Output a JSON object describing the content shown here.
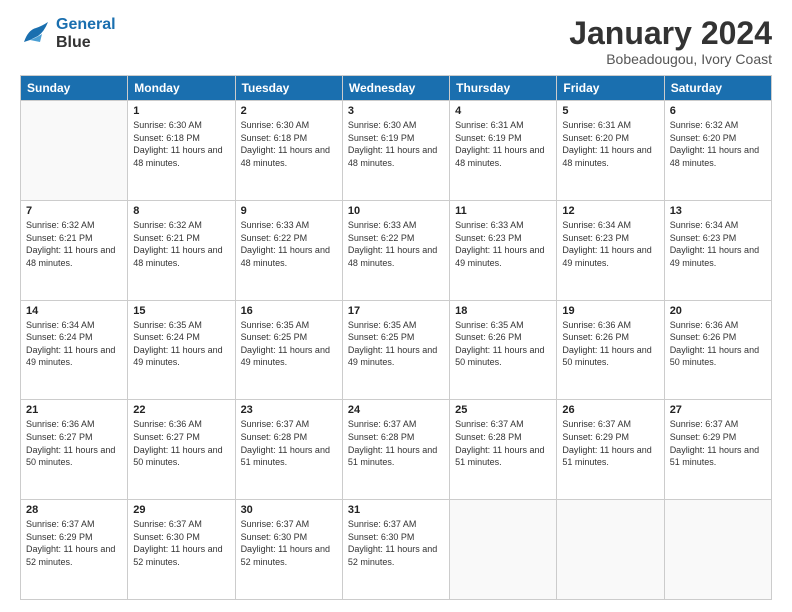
{
  "logo": {
    "line1": "General",
    "line2": "Blue"
  },
  "title": "January 2024",
  "location": "Bobeadougou, Ivory Coast",
  "days_header": [
    "Sunday",
    "Monday",
    "Tuesday",
    "Wednesday",
    "Thursday",
    "Friday",
    "Saturday"
  ],
  "weeks": [
    [
      {
        "day": "",
        "sunrise": "",
        "sunset": "",
        "daylight": ""
      },
      {
        "day": "1",
        "sunrise": "Sunrise: 6:30 AM",
        "sunset": "Sunset: 6:18 PM",
        "daylight": "Daylight: 11 hours and 48 minutes."
      },
      {
        "day": "2",
        "sunrise": "Sunrise: 6:30 AM",
        "sunset": "Sunset: 6:18 PM",
        "daylight": "Daylight: 11 hours and 48 minutes."
      },
      {
        "day": "3",
        "sunrise": "Sunrise: 6:30 AM",
        "sunset": "Sunset: 6:19 PM",
        "daylight": "Daylight: 11 hours and 48 minutes."
      },
      {
        "day": "4",
        "sunrise": "Sunrise: 6:31 AM",
        "sunset": "Sunset: 6:19 PM",
        "daylight": "Daylight: 11 hours and 48 minutes."
      },
      {
        "day": "5",
        "sunrise": "Sunrise: 6:31 AM",
        "sunset": "Sunset: 6:20 PM",
        "daylight": "Daylight: 11 hours and 48 minutes."
      },
      {
        "day": "6",
        "sunrise": "Sunrise: 6:32 AM",
        "sunset": "Sunset: 6:20 PM",
        "daylight": "Daylight: 11 hours and 48 minutes."
      }
    ],
    [
      {
        "day": "7",
        "sunrise": "Sunrise: 6:32 AM",
        "sunset": "Sunset: 6:21 PM",
        "daylight": "Daylight: 11 hours and 48 minutes."
      },
      {
        "day": "8",
        "sunrise": "Sunrise: 6:32 AM",
        "sunset": "Sunset: 6:21 PM",
        "daylight": "Daylight: 11 hours and 48 minutes."
      },
      {
        "day": "9",
        "sunrise": "Sunrise: 6:33 AM",
        "sunset": "Sunset: 6:22 PM",
        "daylight": "Daylight: 11 hours and 48 minutes."
      },
      {
        "day": "10",
        "sunrise": "Sunrise: 6:33 AM",
        "sunset": "Sunset: 6:22 PM",
        "daylight": "Daylight: 11 hours and 48 minutes."
      },
      {
        "day": "11",
        "sunrise": "Sunrise: 6:33 AM",
        "sunset": "Sunset: 6:23 PM",
        "daylight": "Daylight: 11 hours and 49 minutes."
      },
      {
        "day": "12",
        "sunrise": "Sunrise: 6:34 AM",
        "sunset": "Sunset: 6:23 PM",
        "daylight": "Daylight: 11 hours and 49 minutes."
      },
      {
        "day": "13",
        "sunrise": "Sunrise: 6:34 AM",
        "sunset": "Sunset: 6:23 PM",
        "daylight": "Daylight: 11 hours and 49 minutes."
      }
    ],
    [
      {
        "day": "14",
        "sunrise": "Sunrise: 6:34 AM",
        "sunset": "Sunset: 6:24 PM",
        "daylight": "Daylight: 11 hours and 49 minutes."
      },
      {
        "day": "15",
        "sunrise": "Sunrise: 6:35 AM",
        "sunset": "Sunset: 6:24 PM",
        "daylight": "Daylight: 11 hours and 49 minutes."
      },
      {
        "day": "16",
        "sunrise": "Sunrise: 6:35 AM",
        "sunset": "Sunset: 6:25 PM",
        "daylight": "Daylight: 11 hours and 49 minutes."
      },
      {
        "day": "17",
        "sunrise": "Sunrise: 6:35 AM",
        "sunset": "Sunset: 6:25 PM",
        "daylight": "Daylight: 11 hours and 49 minutes."
      },
      {
        "day": "18",
        "sunrise": "Sunrise: 6:35 AM",
        "sunset": "Sunset: 6:26 PM",
        "daylight": "Daylight: 11 hours and 50 minutes."
      },
      {
        "day": "19",
        "sunrise": "Sunrise: 6:36 AM",
        "sunset": "Sunset: 6:26 PM",
        "daylight": "Daylight: 11 hours and 50 minutes."
      },
      {
        "day": "20",
        "sunrise": "Sunrise: 6:36 AM",
        "sunset": "Sunset: 6:26 PM",
        "daylight": "Daylight: 11 hours and 50 minutes."
      }
    ],
    [
      {
        "day": "21",
        "sunrise": "Sunrise: 6:36 AM",
        "sunset": "Sunset: 6:27 PM",
        "daylight": "Daylight: 11 hours and 50 minutes."
      },
      {
        "day": "22",
        "sunrise": "Sunrise: 6:36 AM",
        "sunset": "Sunset: 6:27 PM",
        "daylight": "Daylight: 11 hours and 50 minutes."
      },
      {
        "day": "23",
        "sunrise": "Sunrise: 6:37 AM",
        "sunset": "Sunset: 6:28 PM",
        "daylight": "Daylight: 11 hours and 51 minutes."
      },
      {
        "day": "24",
        "sunrise": "Sunrise: 6:37 AM",
        "sunset": "Sunset: 6:28 PM",
        "daylight": "Daylight: 11 hours and 51 minutes."
      },
      {
        "day": "25",
        "sunrise": "Sunrise: 6:37 AM",
        "sunset": "Sunset: 6:28 PM",
        "daylight": "Daylight: 11 hours and 51 minutes."
      },
      {
        "day": "26",
        "sunrise": "Sunrise: 6:37 AM",
        "sunset": "Sunset: 6:29 PM",
        "daylight": "Daylight: 11 hours and 51 minutes."
      },
      {
        "day": "27",
        "sunrise": "Sunrise: 6:37 AM",
        "sunset": "Sunset: 6:29 PM",
        "daylight": "Daylight: 11 hours and 51 minutes."
      }
    ],
    [
      {
        "day": "28",
        "sunrise": "Sunrise: 6:37 AM",
        "sunset": "Sunset: 6:29 PM",
        "daylight": "Daylight: 11 hours and 52 minutes."
      },
      {
        "day": "29",
        "sunrise": "Sunrise: 6:37 AM",
        "sunset": "Sunset: 6:30 PM",
        "daylight": "Daylight: 11 hours and 52 minutes."
      },
      {
        "day": "30",
        "sunrise": "Sunrise: 6:37 AM",
        "sunset": "Sunset: 6:30 PM",
        "daylight": "Daylight: 11 hours and 52 minutes."
      },
      {
        "day": "31",
        "sunrise": "Sunrise: 6:37 AM",
        "sunset": "Sunset: 6:30 PM",
        "daylight": "Daylight: 11 hours and 52 minutes."
      },
      {
        "day": "",
        "sunrise": "",
        "sunset": "",
        "daylight": ""
      },
      {
        "day": "",
        "sunrise": "",
        "sunset": "",
        "daylight": ""
      },
      {
        "day": "",
        "sunrise": "",
        "sunset": "",
        "daylight": ""
      }
    ]
  ]
}
